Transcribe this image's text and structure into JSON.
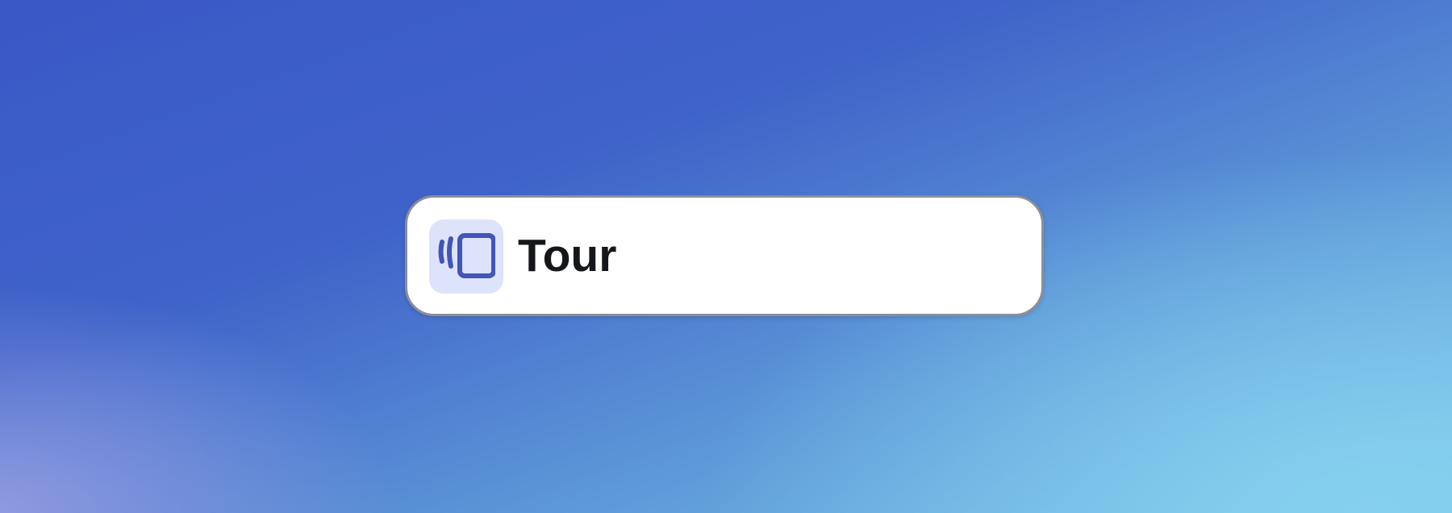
{
  "card": {
    "title": "Tour",
    "icon": "carousel-slides-icon",
    "icon_color": "#4355b9",
    "icon_bg": "#dde3fb"
  }
}
